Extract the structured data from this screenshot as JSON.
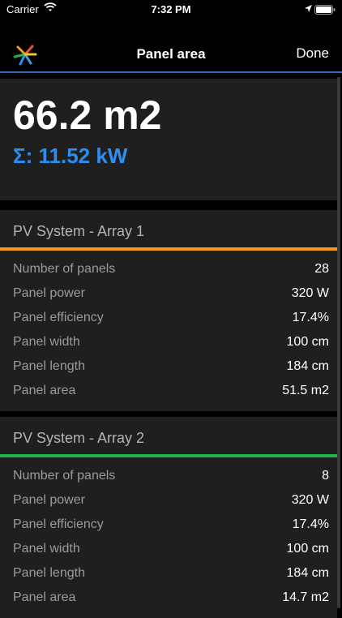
{
  "status": {
    "carrier": "Carrier",
    "time": "7:32 PM"
  },
  "nav": {
    "title": "Panel area",
    "done_label": "Done"
  },
  "summary": {
    "area": "66.2 m2",
    "power": "Σ: 11.52 kW"
  },
  "arrays": [
    {
      "title": "PV System - Array 1",
      "color": "#f39a1c",
      "rows": [
        {
          "label": "Number of panels",
          "value": "28"
        },
        {
          "label": "Panel power",
          "value": "320 W"
        },
        {
          "label": "Panel efficiency",
          "value": "17.4%"
        },
        {
          "label": "Panel width",
          "value": "100 cm"
        },
        {
          "label": "Panel length",
          "value": "184 cm"
        },
        {
          "label": "Panel area",
          "value": "51.5 m2"
        }
      ]
    },
    {
      "title": "PV System - Array 2",
      "color": "#22b34a",
      "rows": [
        {
          "label": "Number of panels",
          "value": "8"
        },
        {
          "label": "Panel power",
          "value": "320 W"
        },
        {
          "label": "Panel efficiency",
          "value": "17.4%"
        },
        {
          "label": "Panel width",
          "value": "100 cm"
        },
        {
          "label": "Panel length",
          "value": "184 cm"
        },
        {
          "label": "Panel area",
          "value": "14.7 m2"
        }
      ]
    }
  ]
}
